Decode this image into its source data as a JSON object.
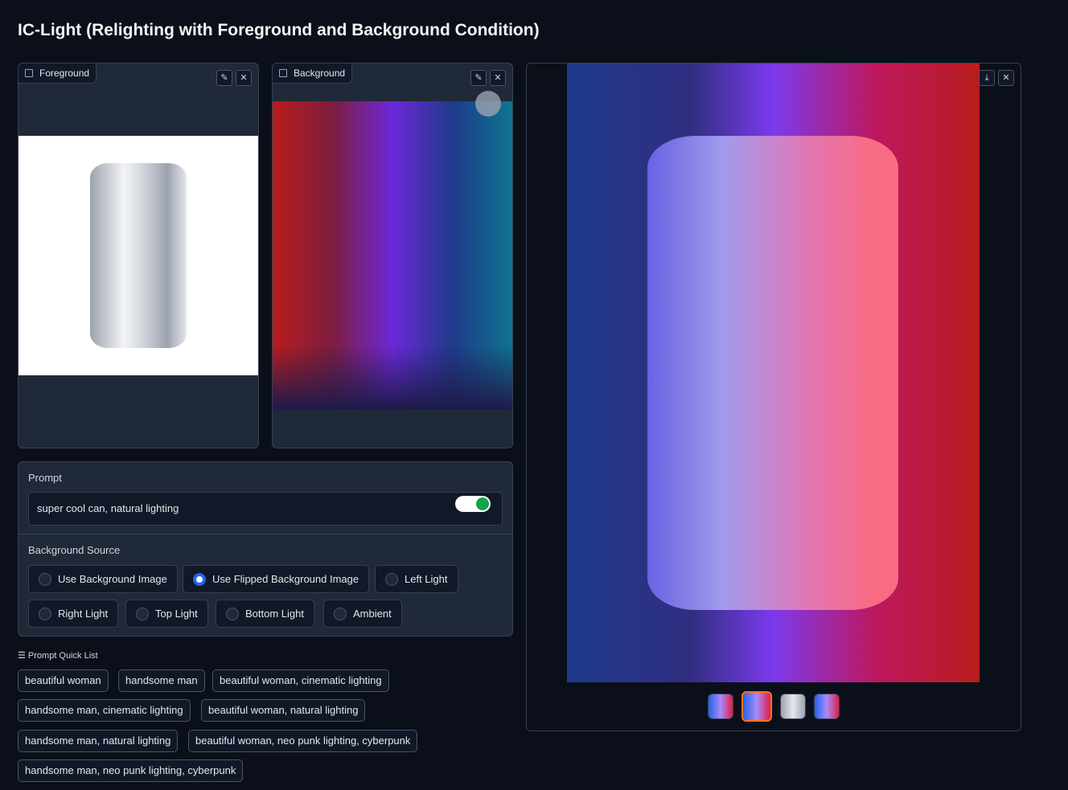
{
  "title": "IC-Light (Relighting with Foreground and Background Condition)",
  "foreground": {
    "label": "Foreground"
  },
  "background": {
    "label": "Background"
  },
  "prompt": {
    "label": "Prompt",
    "value": "super cool  can, natural lighting"
  },
  "bg_source": {
    "label": "Background Source",
    "options": [
      "Use Background Image",
      "Use Flipped Background Image",
      "Left Light",
      "Right Light",
      "Top Light",
      "Bottom Light",
      "Ambient"
    ],
    "selected": "Use Flipped Background Image"
  },
  "quick_list": {
    "label": "Prompt Quick List",
    "items": [
      "beautiful woman",
      "handsome man",
      "beautiful woman, cinematic lighting",
      "handsome man, cinematic lighting",
      "beautiful woman, natural lighting",
      "handsome man, natural lighting",
      "beautiful woman, neo punk lighting, cyberpunk",
      "handsome man, neo punk lighting, cyberpunk"
    ]
  },
  "gallery": {
    "selected_index": 1,
    "count": 4
  },
  "accent": "#f97316"
}
